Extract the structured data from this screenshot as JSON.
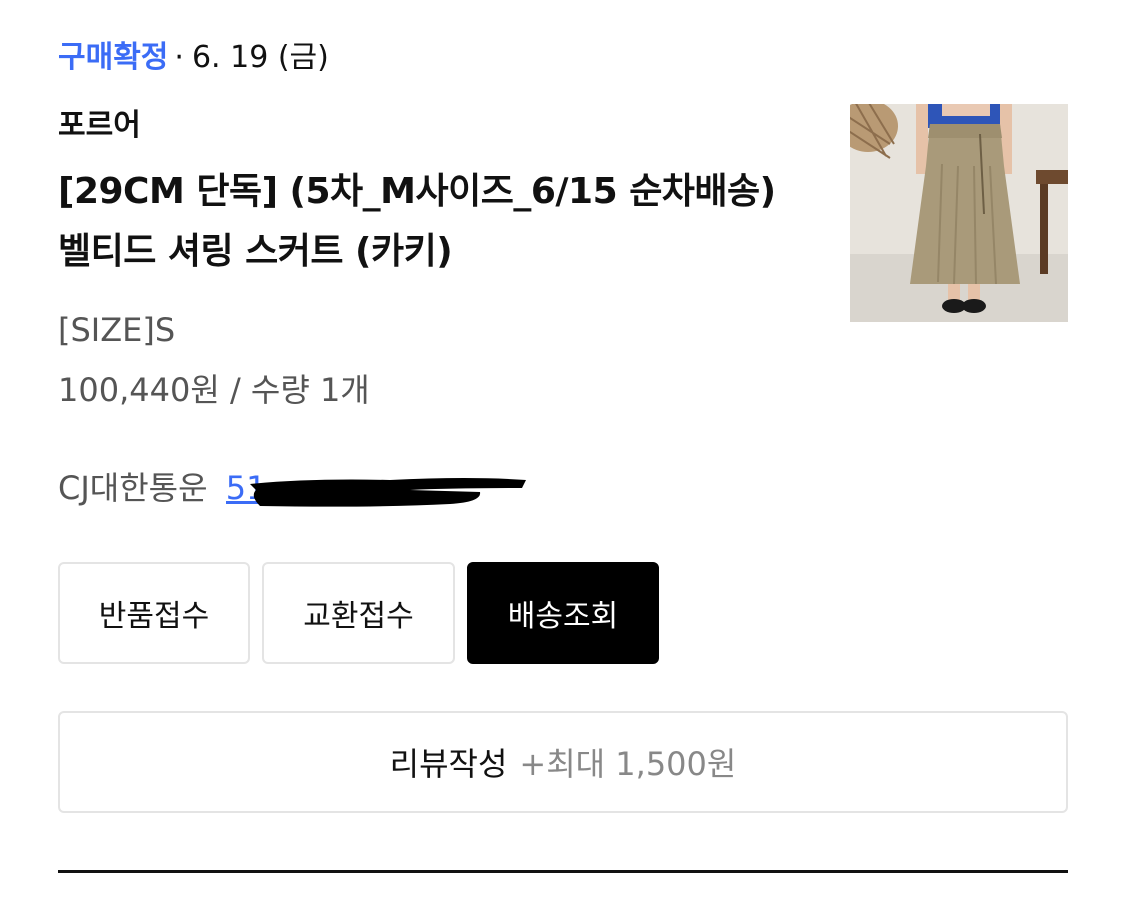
{
  "order": {
    "status": "구매확정",
    "separator": "·",
    "date": "6. 19 (금)",
    "brand": "포르어",
    "title": "[29CM 단독] (5차_M사이즈_6/15 순차배송) 벨티드 셔링 스커트 (카키)",
    "option": "[SIZE]S",
    "price_quantity": "100,440원 / 수량 1개",
    "courier": "CJ대한통운",
    "tracking_number_visible": "51"
  },
  "actions": {
    "return_label": "반품접수",
    "exchange_label": "교환접수",
    "tracking_label": "배송조회"
  },
  "review": {
    "label": "리뷰작성",
    "reward": "+최대 1,500원"
  },
  "colors": {
    "status_blue": "#3b6cf6",
    "primary_button_bg": "#000000"
  },
  "thumbnail": {
    "description_icon": "product-photo-khaki-skirt"
  }
}
